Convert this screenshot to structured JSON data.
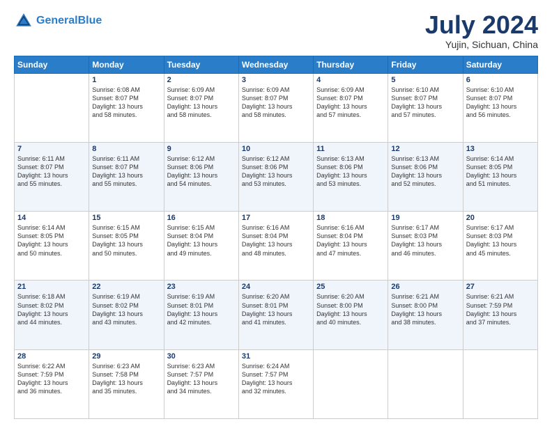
{
  "header": {
    "logo_line1": "General",
    "logo_line2": "Blue",
    "month_title": "July 2024",
    "location": "Yujin, Sichuan, China"
  },
  "weekdays": [
    "Sunday",
    "Monday",
    "Tuesday",
    "Wednesday",
    "Thursday",
    "Friday",
    "Saturday"
  ],
  "weeks": [
    [
      {
        "day": "",
        "info": ""
      },
      {
        "day": "1",
        "info": "Sunrise: 6:08 AM\nSunset: 8:07 PM\nDaylight: 13 hours\nand 58 minutes."
      },
      {
        "day": "2",
        "info": "Sunrise: 6:09 AM\nSunset: 8:07 PM\nDaylight: 13 hours\nand 58 minutes."
      },
      {
        "day": "3",
        "info": "Sunrise: 6:09 AM\nSunset: 8:07 PM\nDaylight: 13 hours\nand 58 minutes."
      },
      {
        "day": "4",
        "info": "Sunrise: 6:09 AM\nSunset: 8:07 PM\nDaylight: 13 hours\nand 57 minutes."
      },
      {
        "day": "5",
        "info": "Sunrise: 6:10 AM\nSunset: 8:07 PM\nDaylight: 13 hours\nand 57 minutes."
      },
      {
        "day": "6",
        "info": "Sunrise: 6:10 AM\nSunset: 8:07 PM\nDaylight: 13 hours\nand 56 minutes."
      }
    ],
    [
      {
        "day": "7",
        "info": "Sunrise: 6:11 AM\nSunset: 8:07 PM\nDaylight: 13 hours\nand 55 minutes."
      },
      {
        "day": "8",
        "info": "Sunrise: 6:11 AM\nSunset: 8:07 PM\nDaylight: 13 hours\nand 55 minutes."
      },
      {
        "day": "9",
        "info": "Sunrise: 6:12 AM\nSunset: 8:06 PM\nDaylight: 13 hours\nand 54 minutes."
      },
      {
        "day": "10",
        "info": "Sunrise: 6:12 AM\nSunset: 8:06 PM\nDaylight: 13 hours\nand 53 minutes."
      },
      {
        "day": "11",
        "info": "Sunrise: 6:13 AM\nSunset: 8:06 PM\nDaylight: 13 hours\nand 53 minutes."
      },
      {
        "day": "12",
        "info": "Sunrise: 6:13 AM\nSunset: 8:06 PM\nDaylight: 13 hours\nand 52 minutes."
      },
      {
        "day": "13",
        "info": "Sunrise: 6:14 AM\nSunset: 8:05 PM\nDaylight: 13 hours\nand 51 minutes."
      }
    ],
    [
      {
        "day": "14",
        "info": "Sunrise: 6:14 AM\nSunset: 8:05 PM\nDaylight: 13 hours\nand 50 minutes."
      },
      {
        "day": "15",
        "info": "Sunrise: 6:15 AM\nSunset: 8:05 PM\nDaylight: 13 hours\nand 50 minutes."
      },
      {
        "day": "16",
        "info": "Sunrise: 6:15 AM\nSunset: 8:04 PM\nDaylight: 13 hours\nand 49 minutes."
      },
      {
        "day": "17",
        "info": "Sunrise: 6:16 AM\nSunset: 8:04 PM\nDaylight: 13 hours\nand 48 minutes."
      },
      {
        "day": "18",
        "info": "Sunrise: 6:16 AM\nSunset: 8:04 PM\nDaylight: 13 hours\nand 47 minutes."
      },
      {
        "day": "19",
        "info": "Sunrise: 6:17 AM\nSunset: 8:03 PM\nDaylight: 13 hours\nand 46 minutes."
      },
      {
        "day": "20",
        "info": "Sunrise: 6:17 AM\nSunset: 8:03 PM\nDaylight: 13 hours\nand 45 minutes."
      }
    ],
    [
      {
        "day": "21",
        "info": "Sunrise: 6:18 AM\nSunset: 8:02 PM\nDaylight: 13 hours\nand 44 minutes."
      },
      {
        "day": "22",
        "info": "Sunrise: 6:19 AM\nSunset: 8:02 PM\nDaylight: 13 hours\nand 43 minutes."
      },
      {
        "day": "23",
        "info": "Sunrise: 6:19 AM\nSunset: 8:01 PM\nDaylight: 13 hours\nand 42 minutes."
      },
      {
        "day": "24",
        "info": "Sunrise: 6:20 AM\nSunset: 8:01 PM\nDaylight: 13 hours\nand 41 minutes."
      },
      {
        "day": "25",
        "info": "Sunrise: 6:20 AM\nSunset: 8:00 PM\nDaylight: 13 hours\nand 40 minutes."
      },
      {
        "day": "26",
        "info": "Sunrise: 6:21 AM\nSunset: 8:00 PM\nDaylight: 13 hours\nand 38 minutes."
      },
      {
        "day": "27",
        "info": "Sunrise: 6:21 AM\nSunset: 7:59 PM\nDaylight: 13 hours\nand 37 minutes."
      }
    ],
    [
      {
        "day": "28",
        "info": "Sunrise: 6:22 AM\nSunset: 7:59 PM\nDaylight: 13 hours\nand 36 minutes."
      },
      {
        "day": "29",
        "info": "Sunrise: 6:23 AM\nSunset: 7:58 PM\nDaylight: 13 hours\nand 35 minutes."
      },
      {
        "day": "30",
        "info": "Sunrise: 6:23 AM\nSunset: 7:57 PM\nDaylight: 13 hours\nand 34 minutes."
      },
      {
        "day": "31",
        "info": "Sunrise: 6:24 AM\nSunset: 7:57 PM\nDaylight: 13 hours\nand 32 minutes."
      },
      {
        "day": "",
        "info": ""
      },
      {
        "day": "",
        "info": ""
      },
      {
        "day": "",
        "info": ""
      }
    ]
  ]
}
